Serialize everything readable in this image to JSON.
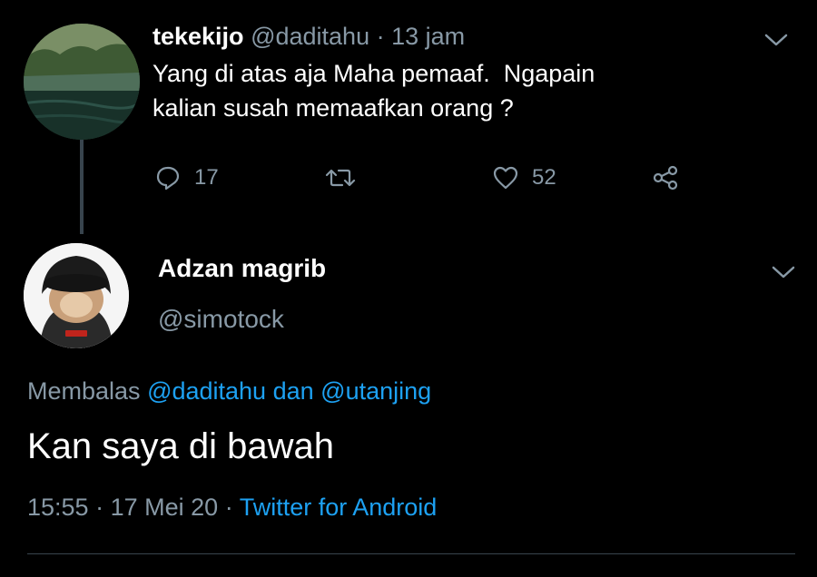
{
  "parent_tweet": {
    "name": "tekekijo",
    "handle": "@daditahu",
    "separator": "·",
    "time": "13 jam",
    "text_line1": "Yang di atas aja Maha pemaaf.  Ngapain",
    "text_line2": "kalian susah memaafkan orang ?",
    "actions": {
      "reply_count": "17",
      "like_count": "52"
    }
  },
  "reply_tweet": {
    "name": "Adzan magrib",
    "handle": "@simotock",
    "replying_prefix": "Membalas",
    "replying_mention1": "@daditahu",
    "replying_conjunction": "dan",
    "replying_mention2": "@utanjing",
    "text": "Kan saya di bawah",
    "time": "15:55",
    "separator1": "·",
    "date": "17 Mei 20",
    "separator2": "·",
    "source": "Twitter for Android"
  },
  "icons": {
    "reply": "reply-icon",
    "retweet": "retweet-icon",
    "like": "heart-icon",
    "share": "share-icon",
    "menu": "chevron-down-icon"
  },
  "colors": {
    "background": "#000000",
    "primary_text": "#ffffff",
    "secondary_text": "#8899a6",
    "accent": "#1da1f2",
    "divider": "#38444d"
  }
}
